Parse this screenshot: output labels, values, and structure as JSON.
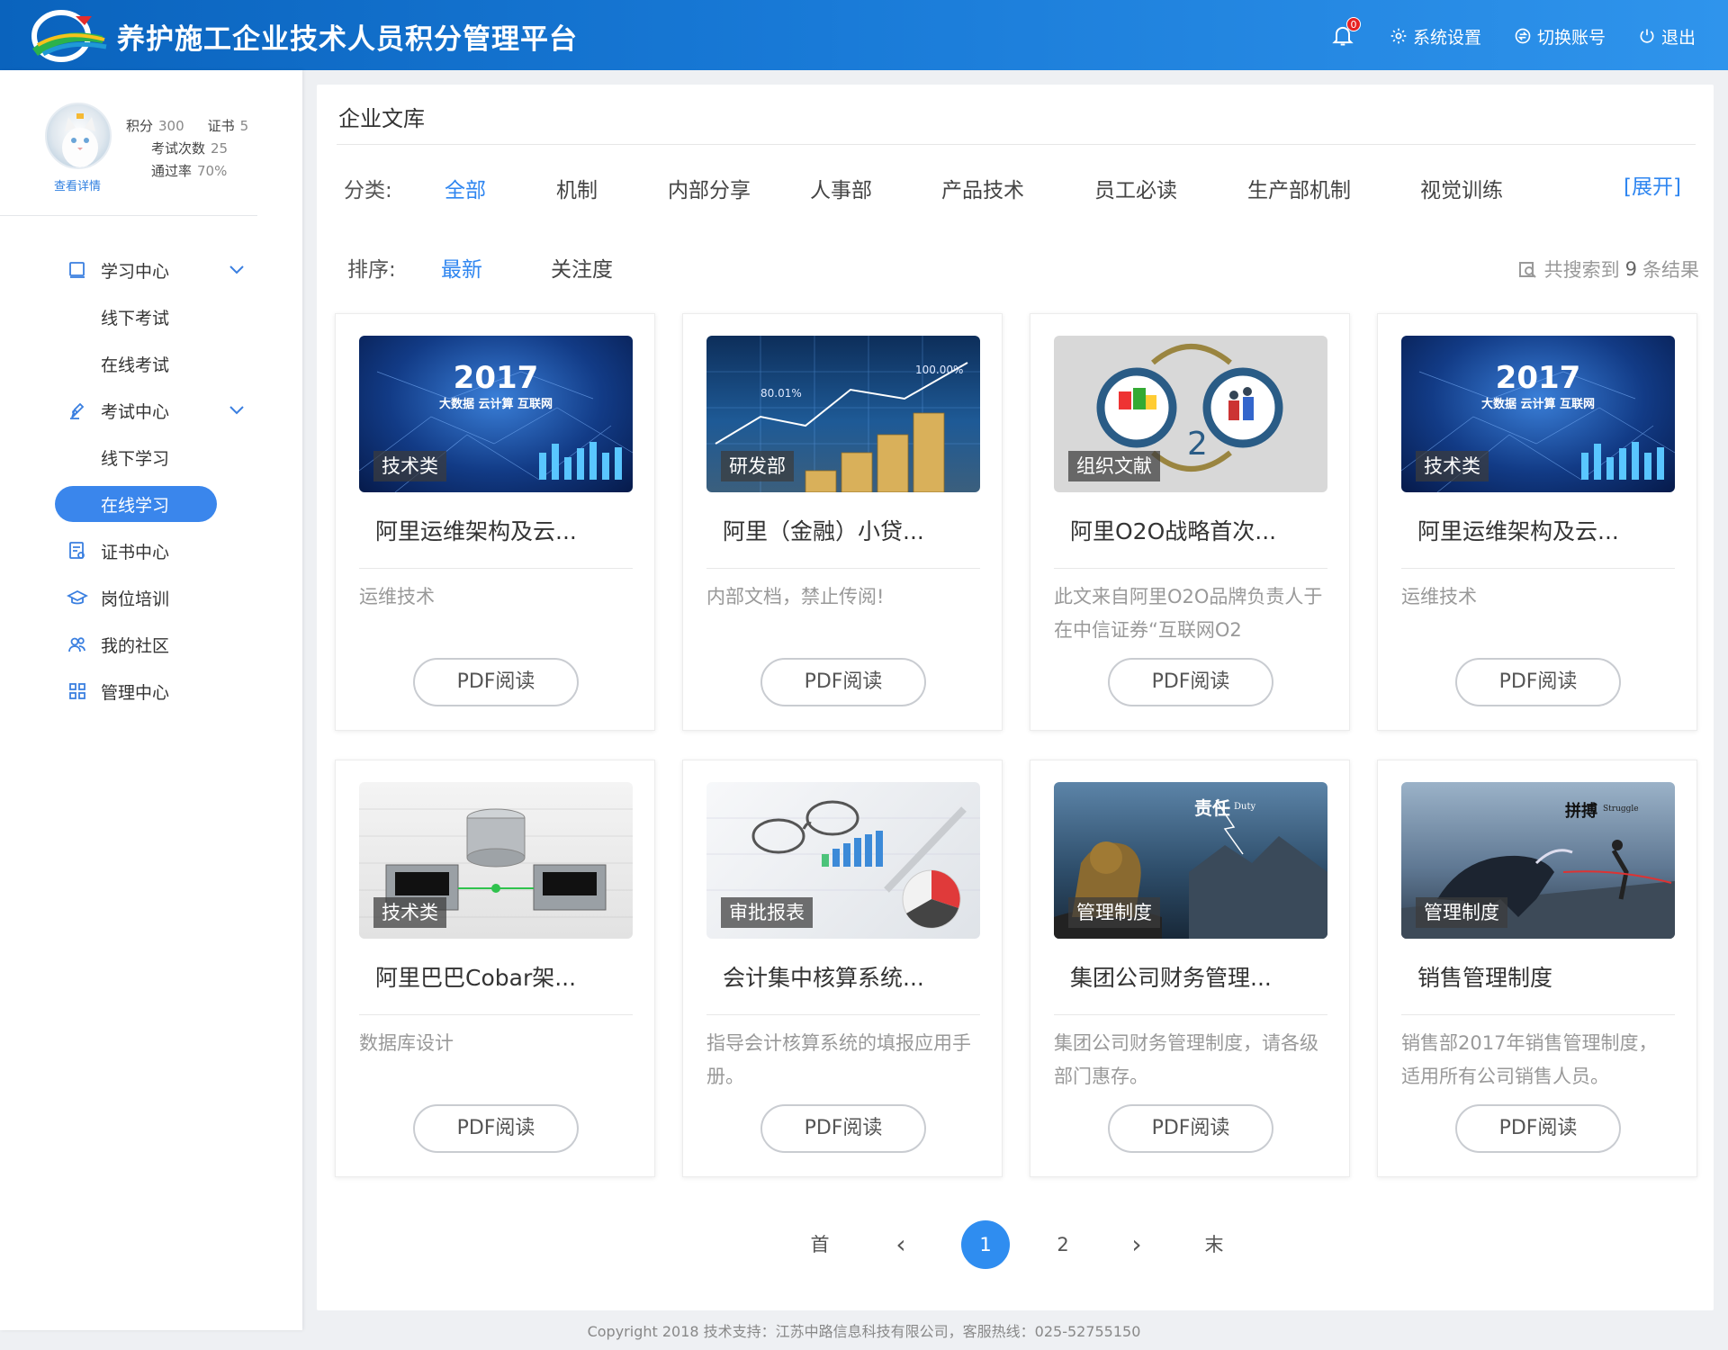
{
  "header": {
    "title": "养护施工企业技术人员积分管理平台",
    "notification_count": "0",
    "settings_label": "系统设置",
    "switch_account_label": "切换账号",
    "logout_label": "退出"
  },
  "profile": {
    "view_details": "查看详情",
    "points_label": "积分",
    "points_value": "300",
    "certs_label": "证书",
    "certs_value": "5",
    "exams_label": "考试次数",
    "exams_value": "25",
    "pass_label": "通过率",
    "pass_value": "70%"
  },
  "menu": {
    "learning_center": "学习中心",
    "offline_exam": "线下考试",
    "online_exam": "在线考试",
    "exam_center": "考试中心",
    "offline_study": "线下学习",
    "online_study": "在线学习",
    "cert_center": "证书中心",
    "post_training": "岗位培训",
    "my_community": "我的社区",
    "admin_center": "管理中心"
  },
  "library": {
    "title": "企业文库",
    "category_label": "分类:",
    "categories": [
      "全部",
      "机制",
      "内部分享",
      "人事部",
      "产品技术",
      "员工必读",
      "生产部机制",
      "视觉训练"
    ],
    "expand_label": "[展开]",
    "sort_label": "排序:",
    "sort_options": [
      "最新",
      "关注度"
    ],
    "result_prefix": "共搜索到",
    "result_count": "9",
    "result_suffix": "条结果"
  },
  "cards": [
    {
      "tag": "技术类",
      "title": "阿里运维架构及云...",
      "desc": "运维技术",
      "button": "PDF阅读"
    },
    {
      "tag": "研发部",
      "title": "阿里（金融）小贷...",
      "desc": "内部文档，禁止传阅!",
      "button": "PDF阅读"
    },
    {
      "tag": "组织文献",
      "title": "阿里O2O战略首次...",
      "desc": "此文来自阿里O2O品牌负责人于在中信证券“互联网O2",
      "button": "PDF阅读"
    },
    {
      "tag": "技术类",
      "title": "阿里运维架构及云...",
      "desc": "运维技术",
      "button": "PDF阅读"
    },
    {
      "tag": "技术类",
      "title": "阿里巴巴Cobar架...",
      "desc": "数据库设计",
      "button": "PDF阅读"
    },
    {
      "tag": "审批报表",
      "title": "会计集中核算系统...",
      "desc": "指导会计核算系统的填报应用手册。",
      "button": "PDF阅读"
    },
    {
      "tag": "管理制度",
      "title": "集团公司财务管理...",
      "desc": "集团公司财务管理制度，请各级部门惠存。",
      "button": "PDF阅读"
    },
    {
      "tag": "管理制度",
      "title": "销售管理制度",
      "desc": "销售部2017年销售管理制度，适用所有公司销售人员。",
      "button": "PDF阅读"
    }
  ],
  "thumb_text": {
    "year": "2017",
    "bigdata_caption": "大数据  云计算  互联网",
    "finance_pct_top": "100.00%",
    "finance_pct_mid": "80.01%",
    "o2o_o": "O",
    "o2o_2": "2",
    "duty_word": "责任",
    "duty_en": "Duty",
    "struggle_word": "拼搏",
    "struggle_en": "Struggle"
  },
  "pagination": {
    "first": "首",
    "prev": "‹",
    "page1": "1",
    "page2": "2",
    "next": "›",
    "last": "末",
    "current": 1
  },
  "footer": {
    "copyright": "Copyright 2018 技术支持：江苏中路信息科技有限公司，客服热线：025-52755150"
  },
  "colors": {
    "header_start": "#0a63bd",
    "header_end": "#2f94ec",
    "accent": "#2f86f0",
    "badge": "#e62222"
  }
}
